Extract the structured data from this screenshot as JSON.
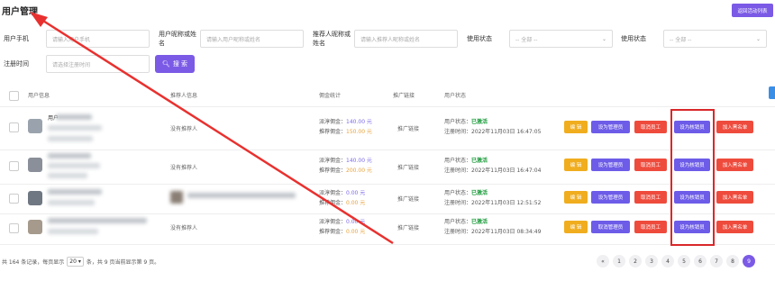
{
  "page": {
    "title": "用户管理",
    "back_button": "返回活动列表"
  },
  "filters": {
    "phone": {
      "label": "用户手机",
      "placeholder": "请输入用户手机"
    },
    "nickname": {
      "label": "用户昵称或姓名",
      "placeholder": "请输入用户昵称或姓名"
    },
    "referrer": {
      "label": "推荐人昵称或姓名",
      "placeholder": "请输入推荐人昵称或姓名"
    },
    "use_status": {
      "label": "使用状态",
      "value": "-- 全部 --"
    },
    "use_status2": {
      "label": "使用状态",
      "value": "-- 全部 --"
    },
    "reg_time": {
      "label": "注册时间",
      "placeholder": "请选择注册时间"
    },
    "search_button": "搜 索"
  },
  "table": {
    "headers": [
      "用户信息",
      "推荐人信息",
      "佣金统计",
      "推广链接",
      "用户状态"
    ],
    "rows": [
      {
        "user_prefix": "用户",
        "referrer": "没有推荐人",
        "pending_label": "派淳佣金：",
        "pending": "140.00 元",
        "rec_label": "推荐佣金：",
        "rec": "150.00 元",
        "link": "推广链接",
        "status_label": "用户状态：",
        "status": "已激活",
        "reg_label": "注册时间：",
        "reg_time": "2022年11月03日 16:47:05",
        "edit": "编 辑",
        "admin": "设为管理员",
        "cancel": "取消员工",
        "writeoff": "设为核销员",
        "blacklist": "加入黑名单"
      },
      {
        "user_prefix": "",
        "referrer": "没有推荐人",
        "pending_label": "派淳佣金：",
        "pending": "140.00 元",
        "rec_label": "推荐佣金：",
        "rec": "200.00 元",
        "link": "推广链接",
        "status_label": "用户状态：",
        "status": "已激活",
        "reg_label": "注册时间：",
        "reg_time": "2022年11月03日 16:47:04",
        "edit": "编 辑",
        "admin": "设为管理员",
        "cancel": "取消员工",
        "writeoff": "设为核销员",
        "blacklist": "加入黑名单"
      },
      {
        "user_prefix": "",
        "referrer": "",
        "pending_label": "派淳佣金：",
        "pending": "0.00 元",
        "rec_label": "推荐佣金：",
        "rec": "0.00 元",
        "link": "推广链接",
        "status_label": "用户状态：",
        "status": "已激活",
        "reg_label": "注册时间：",
        "reg_time": "2022年11月03日 12:51:52",
        "edit": "编 辑",
        "admin": "设为管理员",
        "cancel": "取消员工",
        "writeoff": "设为核销员",
        "blacklist": "加入黑名单"
      },
      {
        "user_prefix": "",
        "referrer": "没有推荐人",
        "pending_label": "派淳佣金：",
        "pending": "0.00 元",
        "rec_label": "推荐佣金：",
        "rec": "0.00 元",
        "link": "推广链接",
        "status_label": "用户状态：",
        "status": "已激活",
        "reg_label": "注册时间：",
        "reg_time": "2022年11月03日 08:34:49",
        "edit": "编 辑",
        "admin": "取消管理员",
        "cancel": "取消员工",
        "writeoff": "设为核销员",
        "blacklist": "加入黑名单"
      }
    ]
  },
  "footer": {
    "prefix": "共 164 条记录，每页显示",
    "page_size": "20",
    "suffix": "条，共 9 页当前显示第 9 页。"
  },
  "pagination": {
    "prev": "«",
    "pages": [
      "1",
      "2",
      "3",
      "4",
      "5",
      "6",
      "7",
      "8",
      "9"
    ],
    "current": "9"
  },
  "annotation": {
    "arrow_color": "#e8312f",
    "box_color": "#d9282a"
  }
}
